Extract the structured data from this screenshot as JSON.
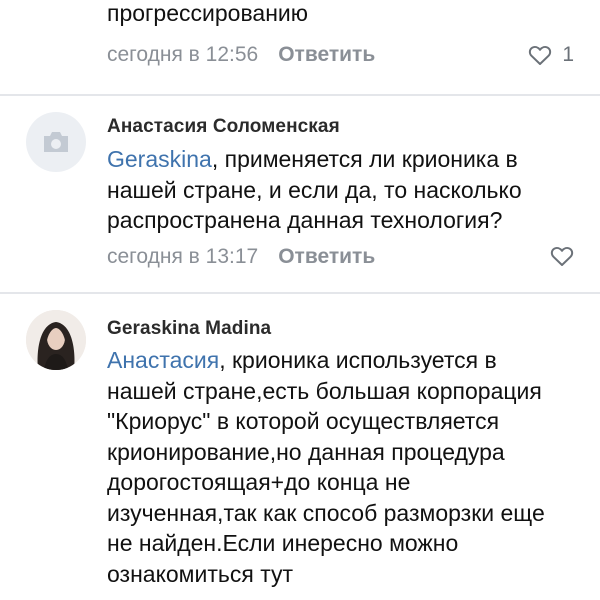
{
  "comments": [
    {
      "text_tail": "прогрессированию",
      "time": "сегодня в 12:56",
      "reply_label": "Ответить",
      "likes": "1"
    },
    {
      "author": "Анастасия Соломенская",
      "mention": "Geraskina",
      "text": ", применяется ли крионика в нашей стране, и если да, то насколько распространена данная технология?",
      "time": "сегодня в 13:17",
      "reply_label": "Ответить"
    },
    {
      "author": "Geraskina Madina",
      "mention": "Анастасия",
      "text": ", крионика используется в нашей стране,есть большая корпорация \"Криорус\" в которой осуществляется крионирование,но данная процедура дорогостоящая+до конца не изученная,так как способ разморзки еще не найден.Если инересно можно ознакомиться тут"
    }
  ],
  "colors": {
    "link": "#3f73ad",
    "meta": "#8a8f96",
    "divider": "#e4e6ea"
  }
}
